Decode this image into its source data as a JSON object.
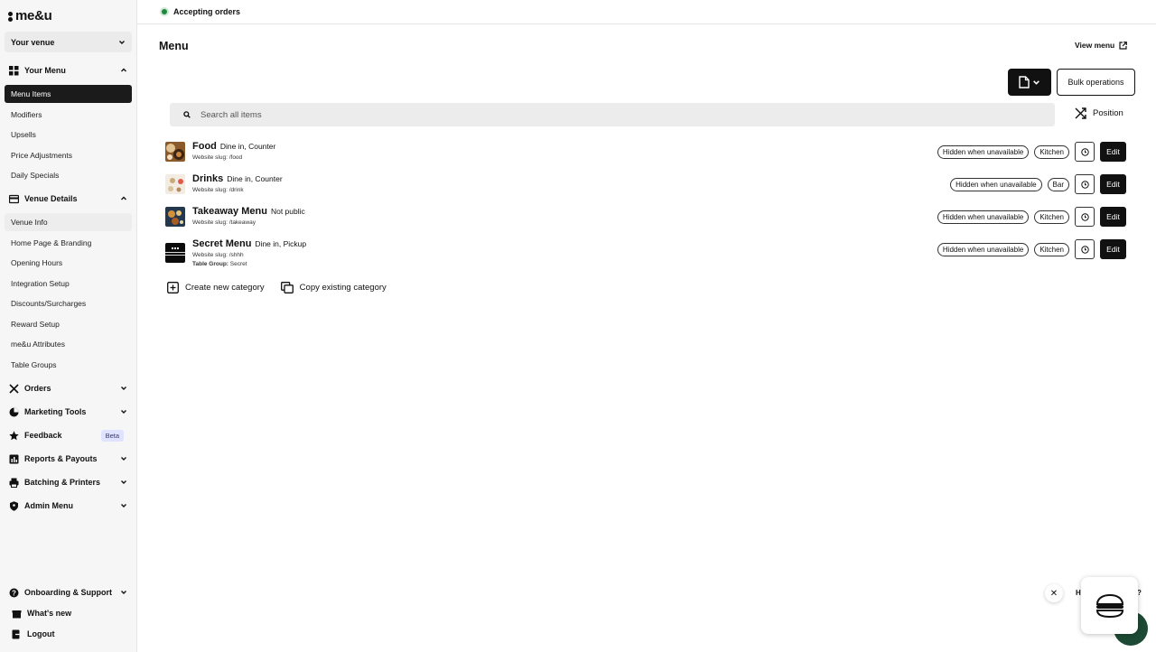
{
  "brand": {
    "logo_text": "me&u"
  },
  "sidebar": {
    "venue_label": "Your venue",
    "sections": {
      "your_menu": "Your Menu",
      "venue_details": "Venue Details",
      "orders": "Orders",
      "marketing_tools": "Marketing Tools",
      "feedback": "Feedback",
      "feedback_badge": "Beta",
      "reports_payouts": "Reports & Payouts",
      "batching_printers": "Batching & Printers",
      "admin_menu": "Admin Menu",
      "onboarding_support": "Onboarding & Support",
      "whats_new": "What's new",
      "logout": "Logout"
    },
    "menu_items": [
      "Menu Items",
      "Modifiers",
      "Upsells",
      "Price Adjustments",
      "Daily Specials"
    ],
    "venue_items": [
      "Venue Info",
      "Home Page & Branding",
      "Opening Hours",
      "Integration Setup",
      "Discounts/Surcharges",
      "Reward Setup",
      "me&u Attributes",
      "Table Groups"
    ]
  },
  "topbar": {
    "status": "Accepting orders",
    "status_color": "#1d8a3b"
  },
  "main": {
    "title": "Menu",
    "view_menu": "View menu",
    "bulk_operations": "Bulk operations",
    "search_placeholder": "Search all items",
    "position_label": "Position",
    "categories": [
      {
        "name": "Food",
        "tags": "Dine in, Counter",
        "slug": "Website slug: /food",
        "pills": [
          "Hidden when unavailable",
          "Kitchen"
        ],
        "edit": "Edit"
      },
      {
        "name": "Drinks",
        "tags": "Dine in, Counter",
        "slug": "Website slug: /drink",
        "pills": [
          "Hidden when unavailable",
          "Bar"
        ],
        "edit": "Edit"
      },
      {
        "name": "Takeaway Menu",
        "tags": "Not public",
        "slug": "Website slug: /takeaway",
        "pills": [
          "Hidden when unavailable",
          "Kitchen"
        ],
        "edit": "Edit"
      },
      {
        "name": "Secret Menu",
        "tags": "Dine in, Pickup",
        "slug": "Website slug: /shhh",
        "group_label": "Table Group:",
        "group_value": "Secret",
        "pills": [
          "Hidden when unavailable",
          "Kitchen"
        ],
        "edit": "Edit"
      }
    ],
    "create_category": "Create new category",
    "copy_category": "Copy existing category"
  },
  "help": {
    "text_start": "H",
    "text_end": "?"
  }
}
